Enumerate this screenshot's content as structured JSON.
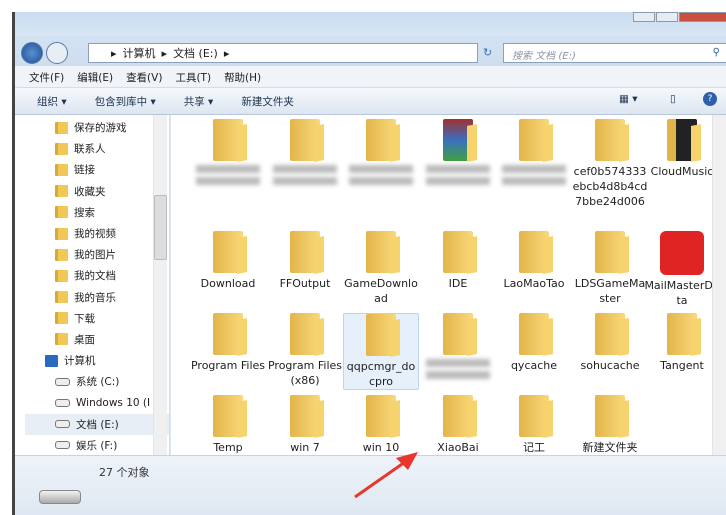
{
  "window": {
    "controls": [
      "minimize",
      "maximize",
      "close"
    ]
  },
  "address": {
    "path": [
      "计算机",
      "文档 (E:)"
    ],
    "search_placeholder": "搜索 文档 (E:)"
  },
  "menu": [
    "文件(F)",
    "编辑(E)",
    "查看(V)",
    "工具(T)",
    "帮助(H)"
  ],
  "toolbar": [
    "组织 ▾",
    "包含到库中 ▾",
    "共享 ▾",
    "新建文件夹"
  ],
  "sidebar": {
    "items": [
      {
        "label": "保存的游戏",
        "type": "folder"
      },
      {
        "label": "联系人",
        "type": "folder"
      },
      {
        "label": "链接",
        "type": "folder"
      },
      {
        "label": "收藏夹",
        "type": "folder"
      },
      {
        "label": "搜索",
        "type": "folder"
      },
      {
        "label": "我的视频",
        "type": "folder"
      },
      {
        "label": "我的图片",
        "type": "folder"
      },
      {
        "label": "我的文档",
        "type": "folder"
      },
      {
        "label": "我的音乐",
        "type": "folder"
      },
      {
        "label": "下载",
        "type": "folder"
      },
      {
        "label": "桌面",
        "type": "folder"
      },
      {
        "label": "计算机",
        "type": "computer"
      },
      {
        "label": "系统 (C:)",
        "type": "drive"
      },
      {
        "label": "Windows 10 (I",
        "type": "drive"
      },
      {
        "label": "文档 (E:)",
        "type": "drive",
        "selected": true
      },
      {
        "label": "娱乐 (F:)",
        "type": "drive"
      }
    ]
  },
  "files": [
    {
      "name": "",
      "blurred": true
    },
    {
      "name": "",
      "blurred": true
    },
    {
      "name": "",
      "blurred": true
    },
    {
      "name": "",
      "blurred": true,
      "icon": "winrar"
    },
    {
      "name": "",
      "blurred": true
    },
    {
      "name": "cef0b574333ebcb4d8b4cd7bbe24d006"
    },
    {
      "name": "CloudMusic",
      "icon": "dark"
    },
    {
      "name": "Download"
    },
    {
      "name": "FFOutput"
    },
    {
      "name": "GameDownload"
    },
    {
      "name": "IDE"
    },
    {
      "name": "LaoMaoTao"
    },
    {
      "name": "LDSGameMaster"
    },
    {
      "name": "MailMasterData",
      "icon": "mailmaster"
    },
    {
      "name": "Program Files"
    },
    {
      "name": "Program Files (x86)"
    },
    {
      "name": "qqpcmgr_docpro",
      "selected": true
    },
    {
      "name": "",
      "blurred": true
    },
    {
      "name": "qycache"
    },
    {
      "name": "sohucache"
    },
    {
      "name": "Tangent"
    },
    {
      "name": "Temp"
    },
    {
      "name": "win 7"
    },
    {
      "name": "win 10"
    },
    {
      "name": "XiaoBai"
    },
    {
      "name": "记工"
    },
    {
      "name": "新建文件夹"
    }
  ],
  "status": {
    "count": "27 个对象"
  },
  "colors": {
    "accent_arrow": "#e8362c",
    "mail_icon": "#e02424"
  }
}
